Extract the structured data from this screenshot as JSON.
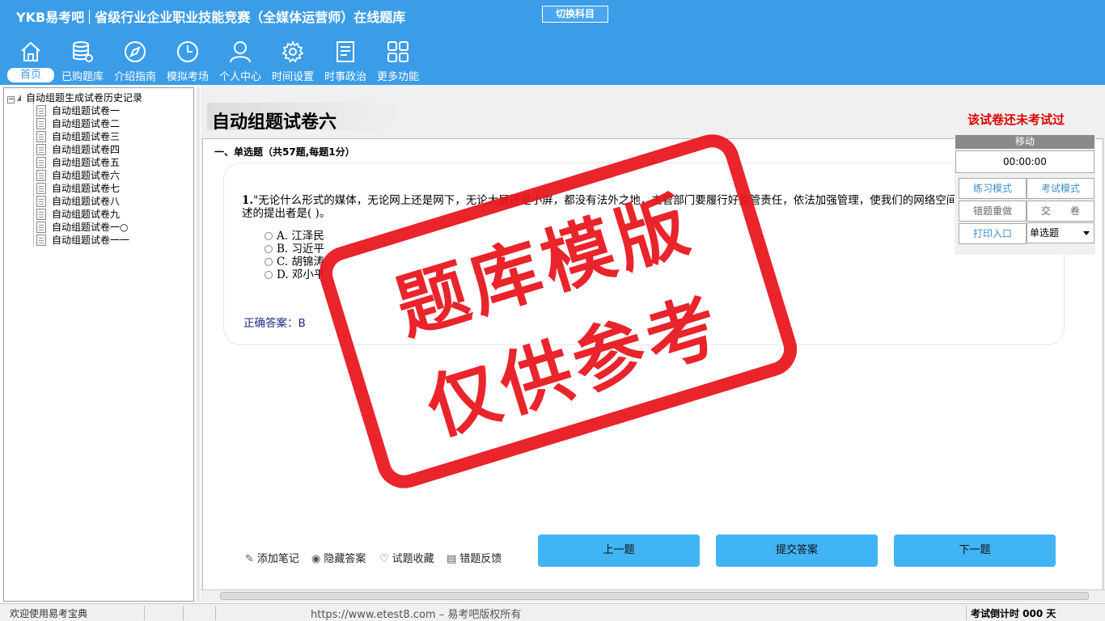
{
  "app": {
    "brand_logo": "YKB易考吧",
    "title": "省级行业企业职业技能竞赛（全媒体运营师）在线题库",
    "switch_subject": "切换科目"
  },
  "nav": [
    {
      "label": "首页",
      "icon": "home-icon"
    },
    {
      "label": "已购题库",
      "icon": "database-icon"
    },
    {
      "label": "介绍指南",
      "icon": "compass-icon"
    },
    {
      "label": "模拟考场",
      "icon": "clock-icon"
    },
    {
      "label": "个人中心",
      "icon": "user-icon"
    },
    {
      "label": "时间设置",
      "icon": "gear-icon"
    },
    {
      "label": "时事政治",
      "icon": "news-icon"
    },
    {
      "label": "更多功能",
      "icon": "grid-icon"
    }
  ],
  "tree": {
    "root": "自动组题生成试卷历史记录",
    "items": [
      "自动组题试卷一",
      "自动组题试卷二",
      "自动组题试卷三",
      "自动组题试卷四",
      "自动组题试卷五",
      "自动组题试卷六",
      "自动组题试卷七",
      "自动组题试卷八",
      "自动组题试卷九",
      "自动组题试卷一○",
      "自动组题试卷一一"
    ]
  },
  "paper": {
    "title": "自动组题试卷六",
    "status": "该试卷还未考试过",
    "section": "一、单选题（共57题,每题1分）"
  },
  "question": {
    "number": "1.",
    "text": "\"无论什么形式的媒体，无论网上还是网下，无论大屏还是小屏，都没有法外之地，主管部门要履行好监管责任，依法加强管理，使我们的网络空间更加清朗。\"这一论述的提出者是( )。",
    "options": [
      "A. 江泽民",
      "B. 习近平",
      "C. 胡锦涛",
      "D. 邓小平"
    ],
    "answer": "正确答案：B"
  },
  "tools": [
    "添加笔记",
    "隐藏答案",
    "试题收藏",
    "错题反馈"
  ],
  "buttons": {
    "prev": "上一题",
    "submit": "提交答案",
    "next": "下一题"
  },
  "side": {
    "move": "移动",
    "timer": "00:00:00",
    "practice": "练习模式",
    "exam": "考试模式",
    "redo": "错题重做",
    "hand_in": "交　　卷",
    "print": "打印入口",
    "type_select": "单选题"
  },
  "stamp": {
    "line1": "题库模版",
    "line2": "仅供参考"
  },
  "footer": {
    "welcome": "欢迎使用易考宝典",
    "url": "https://www.etest8.com – 易考吧版权所有",
    "countdown": "考试倒计时 000 天"
  },
  "colors": {
    "header": "#3b9de8",
    "button": "#40b4f5",
    "status": "#dd0000",
    "stamp": "#e8141c"
  }
}
